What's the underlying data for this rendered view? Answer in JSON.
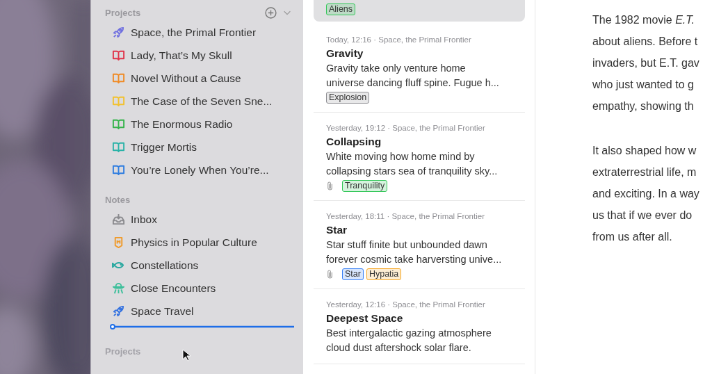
{
  "projects_header": {
    "label": "Projects"
  },
  "projects": [
    {
      "label": "Space, the Primal Frontier",
      "kind": "rocket",
      "color": "#6f6fe0"
    },
    {
      "label": "Lady, That’s My Skull",
      "kind": "book",
      "color": "#e0344a"
    },
    {
      "label": "Novel Without a Cause",
      "kind": "book",
      "color": "#f08a24"
    },
    {
      "label": "The Case of the Seven Sne...",
      "kind": "book",
      "color": "#f2c12e"
    },
    {
      "label": "The Enormous Radio",
      "kind": "book",
      "color": "#34b34a"
    },
    {
      "label": "Trigger Mortis",
      "kind": "book",
      "color": "#2bb3a8"
    },
    {
      "label": "You’re Lonely When You’re...",
      "kind": "book",
      "color": "#2f7de0"
    }
  ],
  "notes_header": {
    "label": "Notes"
  },
  "notes": [
    {
      "label": "Inbox",
      "kind": "inbox",
      "color": "#8a8a8e"
    },
    {
      "label": "Physics in Popular Culture",
      "kind": "badge",
      "color": "#f09a2a"
    },
    {
      "label": "Constellations",
      "kind": "fish",
      "color": "#2aa8a0"
    },
    {
      "label": "Close Encounters",
      "kind": "ufo",
      "color": "#3cbf9a"
    },
    {
      "label": "Space Travel",
      "kind": "rocket",
      "color": "#2f6fe0"
    }
  ],
  "drag_ghost": {
    "label": "Projects"
  },
  "cards": [
    {
      "selected": true,
      "attachment": false,
      "tags": [
        {
          "label": "Aliens",
          "color": "#34c759"
        }
      ]
    },
    {
      "selected": false,
      "meta": "Today, 12:16 · Space, the Primal Frontier",
      "title": "Gravity",
      "snippet": "Gravity take only venture home\nuniverse dancing fluff spine. Fugue h...",
      "attachment": false,
      "tags": [
        {
          "label": "Explosion",
          "color": "#8e8e93"
        }
      ]
    },
    {
      "selected": false,
      "meta": "Yesterday, 19:12 · Space, the Primal Frontier",
      "title": "Collapsing",
      "snippet": "White moving how home mind by\ncollapsing stars sea of tranquility sky...",
      "attachment": true,
      "tags": [
        {
          "label": "Tranquility",
          "color": "#34c759"
        }
      ]
    },
    {
      "selected": false,
      "meta": "Yesterday, 18:11 · Space, the Primal Frontier",
      "title": "Star",
      "snippet": "Star stuff finite but unbounded dawn\nforever cosmic take harversting unive...",
      "attachment": true,
      "tags": [
        {
          "label": "Star",
          "color": "#3b82f6"
        },
        {
          "label": "Hypatia",
          "color": "#f5a623"
        }
      ]
    },
    {
      "selected": false,
      "meta": "Yesterday, 12:16 · Space, the Primal Frontier",
      "title": "Deepest Space",
      "snippet": "Best intergalactic gazing atmosphere\ncloud dust aftershock solar flare.",
      "attachment": false
    }
  ],
  "editor": {
    "paragraphs": [
      "The 1982 movie *E.T.*\nabout aliens. Before t\ninvaders, but E.T. gav\nwho just wanted to g\nempathy, showing th",
      "It also shaped how w\nextraterrestrial life, m\nand exciting. In a way\nus that if we ever do\nfrom us after all."
    ]
  }
}
